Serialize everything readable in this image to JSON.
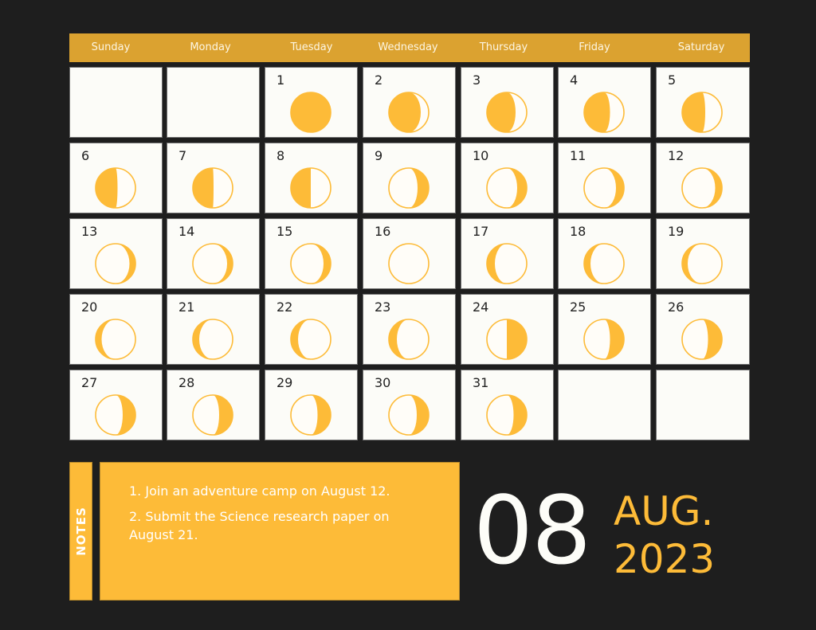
{
  "colors": {
    "accent": "#fdbb38",
    "header": "#dba230",
    "background": "#1e1e1e",
    "cell": "#fcfcf8"
  },
  "weekdays": [
    "Sunday",
    "Monday",
    "Tuesday",
    "Wednesday",
    "Thursday",
    "Friday",
    "Saturday"
  ],
  "first_weekday_index": 2,
  "days": [
    {
      "day": "1",
      "phase": "full-fill"
    },
    {
      "day": "2",
      "phase": "left",
      "fill": 0.8
    },
    {
      "day": "3",
      "phase": "left",
      "fill": 0.72
    },
    {
      "day": "4",
      "phase": "left",
      "fill": 0.65
    },
    {
      "day": "5",
      "phase": "left",
      "fill": 0.58
    },
    {
      "day": "6",
      "phase": "left",
      "fill": 0.55
    },
    {
      "day": "7",
      "phase": "left",
      "fill": 0.52
    },
    {
      "day": "8",
      "phase": "left",
      "fill": 0.5
    },
    {
      "day": "9",
      "phase": "right",
      "fill": 0.28
    },
    {
      "day": "10",
      "phase": "right",
      "fill": 0.24
    },
    {
      "day": "11",
      "phase": "right",
      "fill": 0.2
    },
    {
      "day": "12",
      "phase": "right",
      "fill": 0.17
    },
    {
      "day": "13",
      "phase": "right",
      "fill": 0.15
    },
    {
      "day": "14",
      "phase": "right",
      "fill": 0.14
    },
    {
      "day": "15",
      "phase": "right",
      "fill": 0.18
    },
    {
      "day": "16",
      "phase": "empty"
    },
    {
      "day": "17",
      "phase": "left",
      "fill": 0.2
    },
    {
      "day": "18",
      "phase": "left",
      "fill": 0.16
    },
    {
      "day": "19",
      "phase": "left",
      "fill": 0.14
    },
    {
      "day": "20",
      "phase": "left",
      "fill": 0.15
    },
    {
      "day": "21",
      "phase": "left",
      "fill": 0.16
    },
    {
      "day": "22",
      "phase": "left",
      "fill": 0.18
    },
    {
      "day": "23",
      "phase": "left",
      "fill": 0.2
    },
    {
      "day": "24",
      "phase": "right",
      "fill": 0.5
    },
    {
      "day": "25",
      "phase": "right",
      "fill": 0.35
    },
    {
      "day": "26",
      "phase": "right",
      "fill": 0.35
    },
    {
      "day": "27",
      "phase": "right",
      "fill": 0.32
    },
    {
      "day": "28",
      "phase": "right",
      "fill": 0.34
    },
    {
      "day": "29",
      "phase": "right",
      "fill": 0.33
    },
    {
      "day": "30",
      "phase": "right",
      "fill": 0.3
    },
    {
      "day": "31",
      "phase": "right",
      "fill": 0.33
    }
  ],
  "notes": {
    "label": "NOTES",
    "items": [
      "1. Join an adventure camp on August 12.",
      "2. Submit the Science research paper on August 21."
    ]
  },
  "date_display": {
    "day": "08",
    "month": "AUG.",
    "year": "2023"
  }
}
